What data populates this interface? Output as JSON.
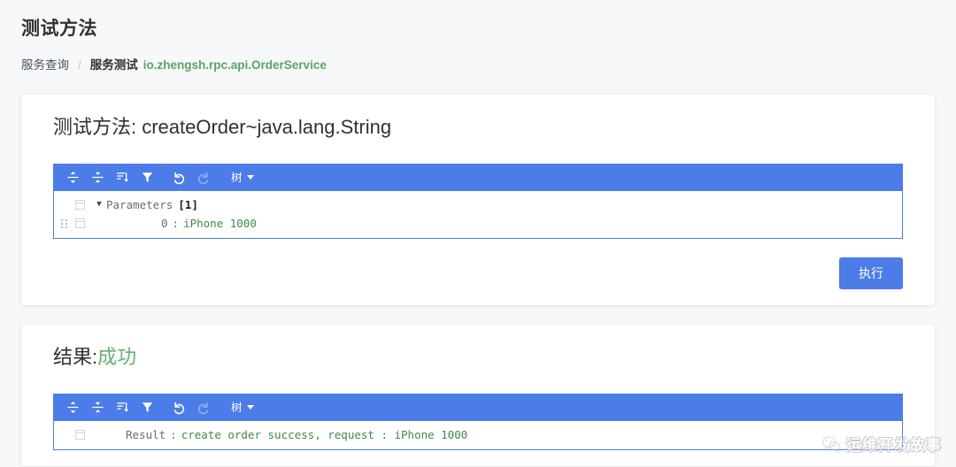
{
  "page": {
    "title": "测试方法"
  },
  "breadcrumb": {
    "home_label": "服务查询",
    "separator": "/",
    "current_label": "服务测试",
    "service_name": "io.zhengsh.rpc.api.OrderService"
  },
  "test_card": {
    "title": "测试方法: createOrder~java.lang.String",
    "editor": {
      "toolbar": {
        "expand_all_icon": "expand-all-icon",
        "collapse_all_icon": "collapse-all-icon",
        "sort_icon": "sort-icon",
        "filter_icon": "filter-icon",
        "undo_icon": "undo-icon",
        "redo_icon": "redo-icon",
        "mode_label": "树"
      },
      "rows": [
        {
          "expander": "▼",
          "key": "Parameters",
          "count": "[1]"
        },
        {
          "key": "0",
          "colon": ":",
          "value": "iPhone 1000"
        }
      ]
    },
    "execute_label": "执行"
  },
  "result_card": {
    "title_prefix": "结果:",
    "title_status": "成功",
    "editor": {
      "toolbar": {
        "expand_all_icon": "expand-all-icon",
        "collapse_all_icon": "collapse-all-icon",
        "sort_icon": "sort-icon",
        "filter_icon": "filter-icon",
        "undo_icon": "undo-icon",
        "redo_icon": "redo-icon",
        "mode_label": "树"
      },
      "rows": [
        {
          "key": "Result",
          "colon": ":",
          "value": "create order success, request : iPhone 1000"
        }
      ]
    }
  },
  "watermark": {
    "logo_icon": "wechat-icon",
    "text": "运维开发故事"
  },
  "colors": {
    "accent_blue": "#4c7ce8",
    "success_green": "#67b06e",
    "string_green": "#3f8a4a",
    "page_bg": "#f7f8f9"
  }
}
